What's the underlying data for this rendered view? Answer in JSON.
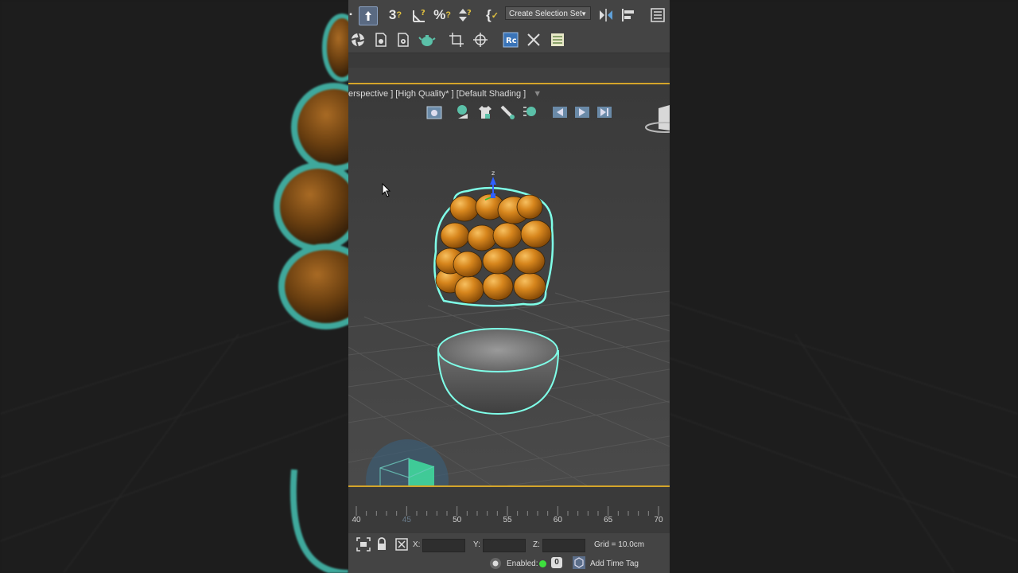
{
  "toolbar": {
    "create_selection_set": "Create Selection Set"
  },
  "viewport": {
    "label": "erspective ] [High Quality* ] [Default Shading ]",
    "axis_label": "z"
  },
  "timeline": {
    "ticks": [
      "40",
      "45",
      "50",
      "55",
      "60",
      "65",
      "70"
    ]
  },
  "status": {
    "x_label": "X:",
    "y_label": "Y:",
    "z_label": "Z:",
    "x_value": "",
    "y_value": "",
    "z_value": "",
    "grid": "Grid = 10.0cm",
    "enabled_label": "Enabled:",
    "enabled_count": "0",
    "add_time_tag": "Add Time Tag"
  },
  "colors": {
    "accent_frame": "#d4a52a",
    "selection_outline": "#7fffe8",
    "fruit": "#d7861d"
  }
}
